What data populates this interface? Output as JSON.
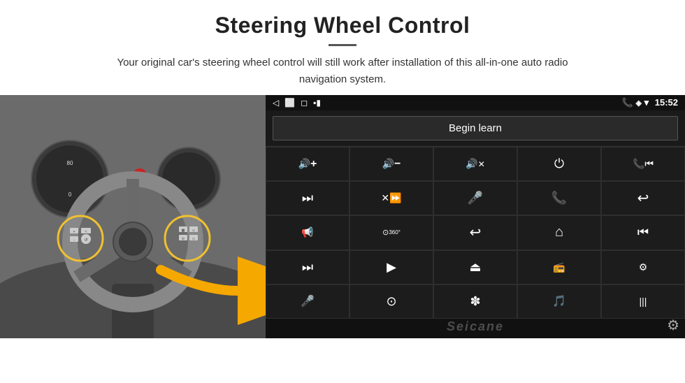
{
  "header": {
    "title": "Steering Wheel Control",
    "subtitle": "Your original car's steering wheel control will still work after installation of this all-in-one auto radio navigation system."
  },
  "android_ui": {
    "status_bar": {
      "back_icon": "◁",
      "home_icon": "⬜",
      "recent_icon": "◻",
      "battery_icon": "▪▮",
      "time": "15:52",
      "phone_icon": "📞",
      "location_icon": "⬦",
      "wifi_icon": "▾"
    },
    "begin_learn_label": "Begin learn",
    "controls": [
      {
        "icon": "🔊+",
        "unicode": "&#x1F50A;&#xFF0B;",
        "name": "vol-up"
      },
      {
        "icon": "🔊-",
        "unicode": "&#x1F508;&#xFF0D;",
        "name": "vol-down"
      },
      {
        "icon": "🔇",
        "unicode": "&#x1F507;",
        "name": "mute"
      },
      {
        "icon": "⏻",
        "unicode": "&#x23FB;",
        "name": "power"
      },
      {
        "icon": "📞⏮",
        "unicode": "&#x260E;&#x23EE;",
        "name": "phone-prev"
      },
      {
        "icon": "⏭",
        "unicode": "&#x23ED;",
        "name": "next-track"
      },
      {
        "icon": "⏩",
        "unicode": "&#x23E9;",
        "name": "fast-forward"
      },
      {
        "icon": "🎤",
        "unicode": "&#x1F3A4;",
        "name": "mic"
      },
      {
        "icon": "📞",
        "unicode": "&#x260E;",
        "name": "phone"
      },
      {
        "icon": "↩",
        "unicode": "&#x2936;",
        "name": "end-call"
      },
      {
        "icon": "🔔",
        "unicode": "&#x1F514;",
        "name": "horn"
      },
      {
        "icon": "360",
        "unicode": "&#x1F441;",
        "name": "360-view"
      },
      {
        "icon": "↩",
        "unicode": "&#x21A9;",
        "name": "back"
      },
      {
        "icon": "🏠",
        "unicode": "&#x2302;",
        "name": "home"
      },
      {
        "icon": "⏮⏮",
        "unicode": "&#x23EE;",
        "name": "prev-track"
      },
      {
        "icon": "⏭⏭",
        "unicode": "&#x23ED;",
        "name": "skip-forward"
      },
      {
        "icon": "▶",
        "unicode": "&#x25B6;",
        "name": "nav"
      },
      {
        "icon": "⏏",
        "unicode": "&#x23CF;",
        "name": "eject"
      },
      {
        "icon": "📻",
        "unicode": "&#x1F4FB;",
        "name": "radio"
      },
      {
        "icon": "≡|",
        "unicode": "&#x2980;",
        "name": "settings"
      },
      {
        "icon": "🎤",
        "unicode": "&#x1F3A4;",
        "name": "voice"
      },
      {
        "icon": "⚙",
        "unicode": "&#x2699;",
        "name": "settings2"
      },
      {
        "icon": "✻",
        "unicode": "&#x2736;",
        "name": "bluetooth"
      },
      {
        "icon": "🎵",
        "unicode": "&#x1F3B5;",
        "name": "music"
      },
      {
        "icon": "|||",
        "unicode": "&#x2980;",
        "name": "equalizer"
      }
    ],
    "watermark": "Seicane"
  }
}
